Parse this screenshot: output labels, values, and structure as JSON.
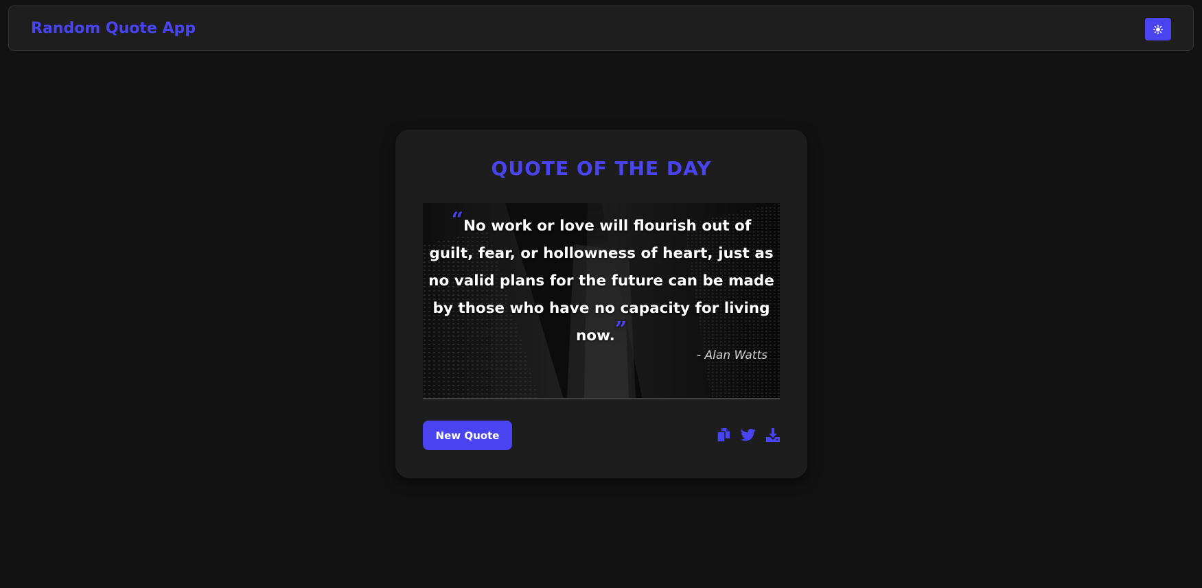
{
  "app": {
    "title": "Random Quote App"
  },
  "theme": {
    "accent": "#4a44f0",
    "background": "#121212",
    "card_background": "#1d1d1d",
    "toggle_icon": "sun-icon"
  },
  "card": {
    "title": "QUOTE OF THE DAY",
    "quote": "No work or love will flourish out of guilt, fear, or hollowness of heart, just as no valid plans for the future can be made by those who have no capacity for living now.",
    "open_quote_mark": "“",
    "close_quote_mark": "”",
    "author": "- Alan Watts",
    "new_quote_label": "New Quote",
    "actions": [
      {
        "icon": "copy-icon"
      },
      {
        "icon": "twitter-icon"
      },
      {
        "icon": "download-icon"
      }
    ]
  }
}
